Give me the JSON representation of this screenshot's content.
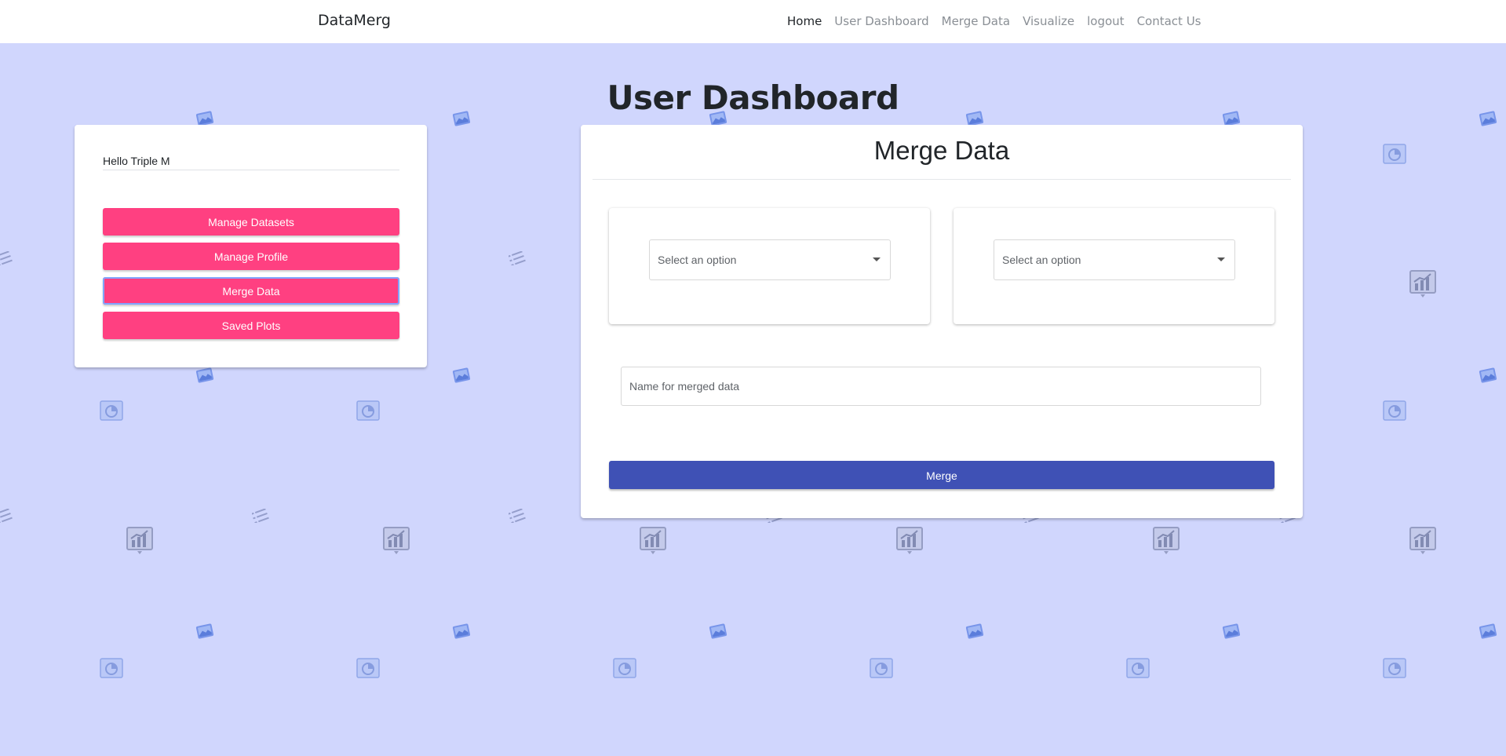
{
  "navbar": {
    "brand": "DataMerg",
    "links": [
      {
        "label": "Home",
        "active": true
      },
      {
        "label": "User Dashboard"
      },
      {
        "label": "Merge Data"
      },
      {
        "label": "Visualize"
      },
      {
        "label": "logout"
      },
      {
        "label": "Contact Us"
      }
    ]
  },
  "page": {
    "title": "User Dashboard",
    "background_color": "#d0d6fd"
  },
  "sidebar": {
    "greeting": "Hello Triple M",
    "buttons": [
      {
        "label": "Manage Datasets"
      },
      {
        "label": "Manage Profile"
      },
      {
        "label": "Merge Data",
        "focused": true
      },
      {
        "label": "Saved Plots"
      }
    ],
    "button_color": "#ff4081"
  },
  "merge": {
    "title": "Merge Data",
    "select_1": {
      "value": "Select an option"
    },
    "select_2": {
      "value": "Select an option"
    },
    "name_placeholder": "Name for merged data",
    "button_label": "Merge",
    "button_color": "#3f51b5"
  },
  "background_icons": [
    "image-icon",
    "list-icon",
    "pie-chart-icon",
    "bar-chart-icon"
  ]
}
